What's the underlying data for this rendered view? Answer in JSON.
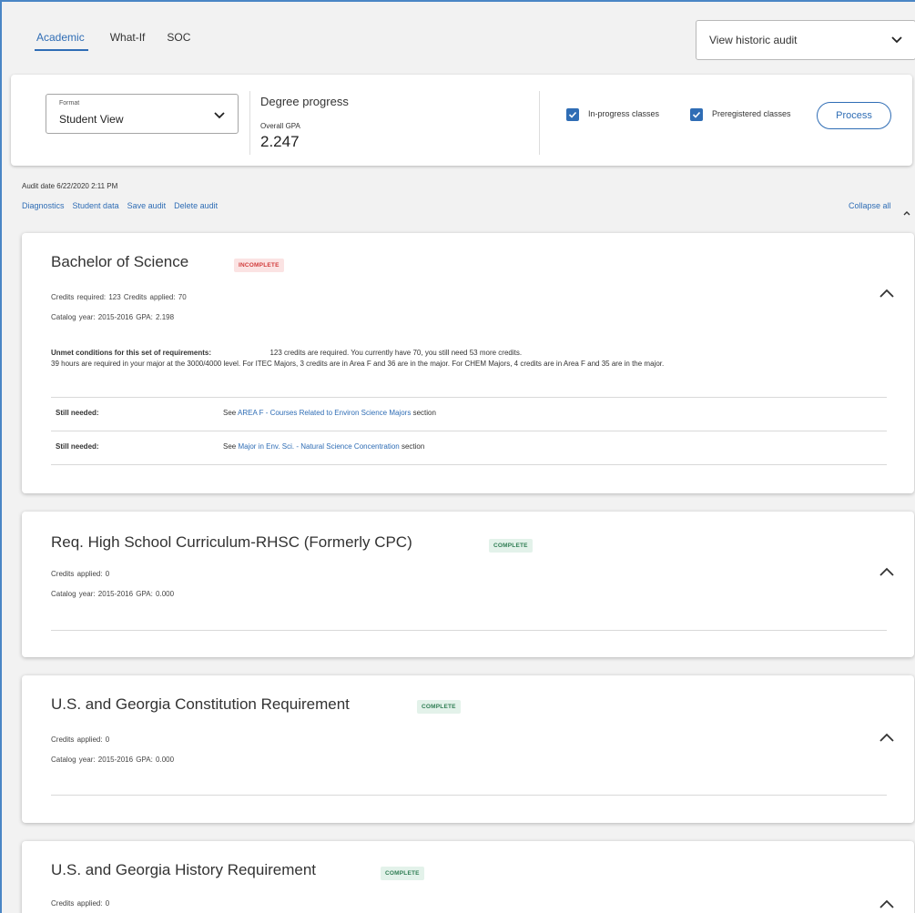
{
  "tabs": [
    {
      "label": "Academic",
      "active": true
    },
    {
      "label": "What-If",
      "active": false
    },
    {
      "label": "SOC",
      "active": false
    }
  ],
  "historic_select": {
    "value": "View historic audit",
    "icon": "chevron-down-icon"
  },
  "format": {
    "label": "Format",
    "value": "Student View"
  },
  "degree_progress": {
    "title": "Degree progress",
    "gpa_label": "Overall GPA",
    "gpa_value": "2.247"
  },
  "options": {
    "in_progress": {
      "label": "In-progress classes",
      "checked": true
    },
    "preregistered": {
      "label": "Preregistered classes",
      "checked": true
    },
    "process_label": "Process"
  },
  "audit": {
    "date": "Audit date 6/22/2020 2:11 PM",
    "links": [
      "Diagnostics",
      "Student data",
      "Save audit",
      "Delete audit"
    ],
    "collapse_all": "Collapse all"
  },
  "blocks": [
    {
      "title": "Bachelor of Science",
      "status": "INCOMPLETE",
      "line1": "Credits required:  123     Credits applied:  70",
      "line2": "Catalog year:  2015-2016     GPA:  2.198",
      "unmet_heading": "Unmet conditions for this set of requirements:",
      "unmet_line1": "123 credits are required. You currently have 70, you still need 53 more credits.",
      "unmet_line2": "39 hours are required in your major at the 3000/4000 level. For ITEC Majors, 3 credits are in Area F and 36 are in the major. For CHEM Majors, 4 credits are in Area F and 35 are in the major.",
      "still_needed": [
        {
          "label": "Still needed:",
          "prefix": "See",
          "link": "AREA F - Courses Related to Environ Science Majors",
          "suffix": "section"
        },
        {
          "label": "Still needed:",
          "prefix": "See",
          "link": "Major in Env. Sci. - Natural Science Concentration",
          "suffix": "section"
        }
      ]
    },
    {
      "title": "Req. High School Curriculum-RHSC (Formerly CPC)",
      "status": "COMPLETE",
      "line1": "Credits applied:  0",
      "line2": "Catalog year:  2015-2016     GPA:  0.000"
    },
    {
      "title": "U.S. and Georgia Constitution Requirement",
      "status": "COMPLETE",
      "line1": "Credits applied:  0",
      "line2": "Catalog year:  2015-2016     GPA:  0.000"
    },
    {
      "title": "U.S. and Georgia History Requirement",
      "status": "COMPLETE",
      "line1": "Credits applied:  0"
    }
  ],
  "colors": {
    "accent": "#2f6db5",
    "incomplete": "#d13b3b",
    "complete": "#2f7d53"
  }
}
